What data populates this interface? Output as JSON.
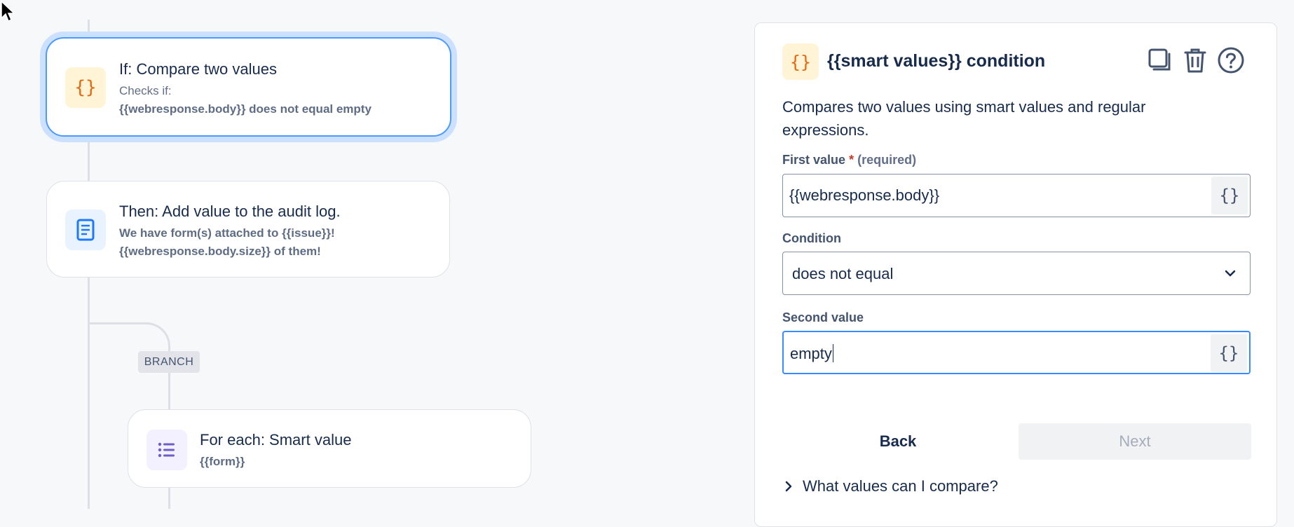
{
  "canvas": {
    "if_card": {
      "title": "If: Compare two values",
      "subtitle": "Checks if:",
      "detail": "{{webresponse.body}} does not equal empty"
    },
    "then_card": {
      "title": "Then: Add value to the audit log.",
      "line1": "We have form(s) attached to {{issue}}!",
      "line2": "{{webresponse.body.size}} of them!"
    },
    "branch_label": "BRANCH",
    "for_each_card": {
      "title": "For each: Smart value",
      "detail": "{{form}}"
    }
  },
  "panel": {
    "title": "{{smart values}} condition",
    "description": "Compares two values using smart values and regular expressions.",
    "first_value": {
      "label": "First value",
      "required_marker": "*",
      "required_text": "(required)",
      "value": "{{webresponse.body}}"
    },
    "condition": {
      "label": "Condition",
      "value": "does not equal"
    },
    "second_value": {
      "label": "Second value",
      "value": "empty"
    },
    "back_label": "Back",
    "next_label": "Next",
    "help_expander": "What values can I compare?"
  },
  "icons": {
    "smart_value": "curly-braces-icon",
    "audit_log": "document-icon",
    "for_each": "list-icon",
    "duplicate": "duplicate-icon",
    "delete": "trash-icon",
    "help": "help-icon",
    "chevron_down": "chevron-down-icon",
    "chevron_right": "chevron-right-icon"
  },
  "colors": {
    "accent": "#388bff",
    "selection_glow": "#cce0ff",
    "smart_icon_bg": "#fff4d6",
    "smart_icon_fg": "#e56910",
    "audit_icon_bg": "#e9f2ff",
    "audit_icon_fg": "#1d7afc",
    "for_each_icon_bg": "#f3f0ff",
    "for_each_icon_fg": "#6e5dc6"
  }
}
